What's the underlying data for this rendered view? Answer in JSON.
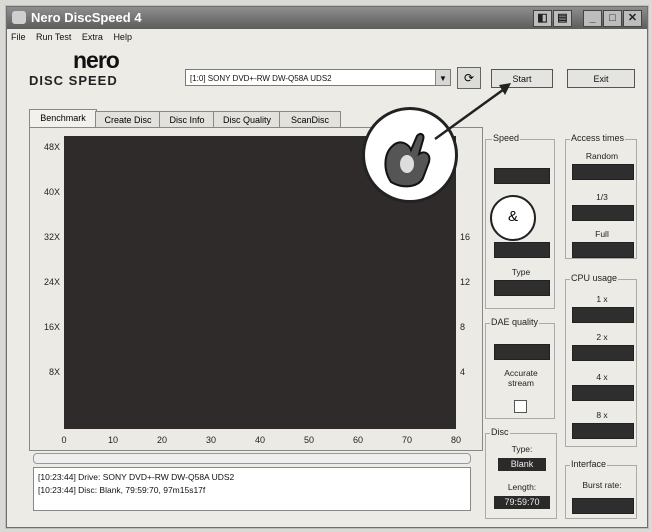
{
  "window": {
    "title": "Nero DiscSpeed 4"
  },
  "menu": [
    "File",
    "Run Test",
    "Extra",
    "Help"
  ],
  "logo": {
    "top": "nero",
    "bottom": "DISC SPEED"
  },
  "drive": {
    "selected": "[1:0]  SONY DVD+-RW DW-Q58A UDS2"
  },
  "buttons": {
    "start": "Start",
    "exit": "Exit"
  },
  "tabs": [
    "Benchmark",
    "Create Disc",
    "Disc Info",
    "Disc Quality",
    "ScanDisc"
  ],
  "chart_data": {
    "type": "line",
    "x_ticks": [
      "0",
      "10",
      "20",
      "30",
      "40",
      "50",
      "60",
      "70",
      "80"
    ],
    "y_left_ticks": [
      "48X",
      "40X",
      "32X",
      "24X",
      "16X",
      "8X"
    ],
    "y_right_ticks": [
      "16",
      "12",
      "8",
      "4"
    ],
    "xlim": [
      0,
      80
    ],
    "series": []
  },
  "speed_panel": {
    "label": "Speed",
    "type_label": "Type"
  },
  "access_panel": {
    "label": "Access times",
    "random": "Random",
    "third": "1/3",
    "full": "Full"
  },
  "cpu_panel": {
    "label": "CPU usage",
    "items": [
      "1 x",
      "2 x",
      "4 x",
      "8 x"
    ]
  },
  "dae_panel": {
    "label": "DAE quality",
    "accurate": "Accurate stream"
  },
  "disc_panel": {
    "label": "Disc",
    "type_label": "Type:",
    "type_value": "Blank",
    "length_label": "Length:",
    "length_value": "79:59:70"
  },
  "interface_panel": {
    "label": "Interface",
    "burst": "Burst rate:"
  },
  "log": [
    "[10:23:44]  Drive: SONY    DVD+-RW DW-Q58A  UDS2",
    "[10:23:44]  Disc: Blank, 79:59:70, 97m15s17f"
  ]
}
